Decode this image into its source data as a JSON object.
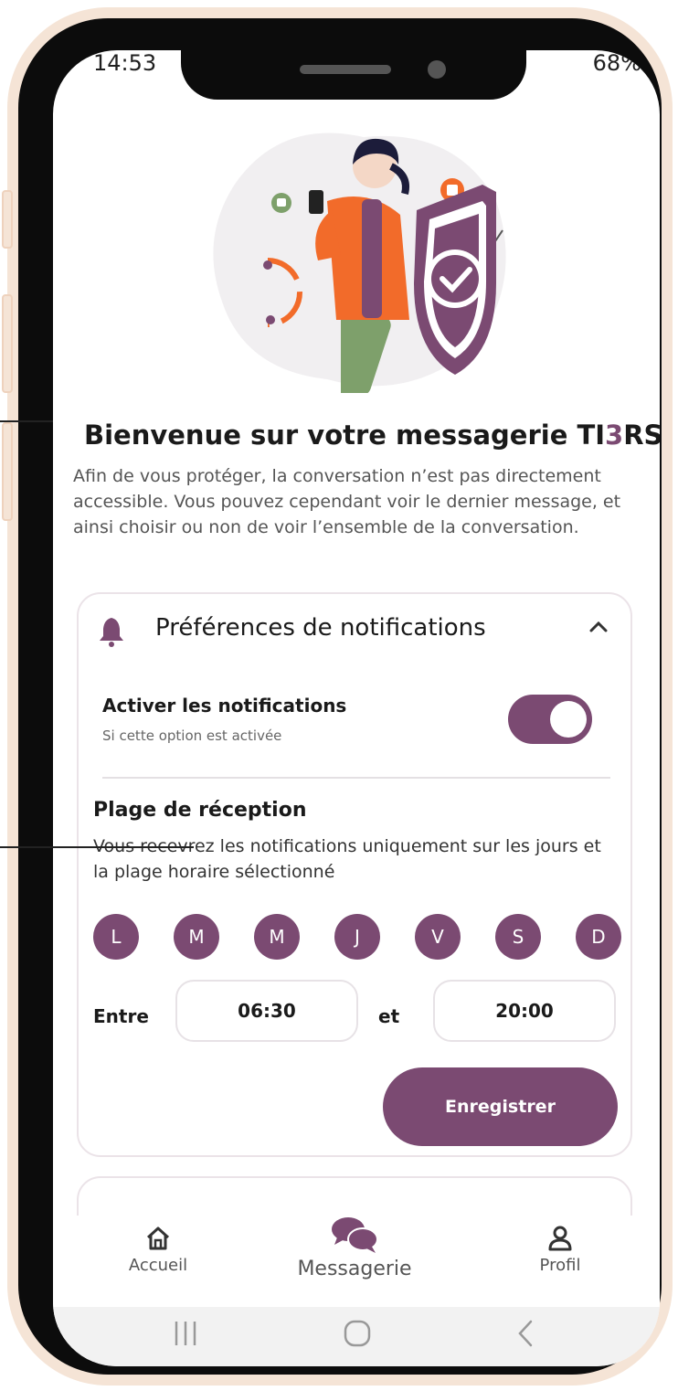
{
  "status": {
    "time": "14:53",
    "battery": "68%"
  },
  "welcome": {
    "title_prefix": "Bienvenue sur votre messagerie TI",
    "title_accent": "3",
    "title_suffix": "RS",
    "description": "Afin de vous protéger, la conversation n’est pas directement accessible. Vous pouvez cependant voir le dernier message, et ainsi choisir ou non de voir l’ensemble de la conversation."
  },
  "notifications": {
    "title": "Préférences de notifications",
    "toggle_label": "Activer les notifications",
    "toggle_hint": "Si cette option est activée",
    "toggle_on": true,
    "plage_title": "Plage de réception",
    "plage_desc": "Vous recevrez les notifications uniquement sur les jours et la plage horaire sélectionné",
    "days": [
      "L",
      "M",
      "M",
      "J",
      "V",
      "S",
      "D"
    ],
    "entre_label": "Entre",
    "et_label": "et",
    "start_time": "06:30",
    "end_time": "20:00",
    "save_label": "Enregistrer"
  },
  "nav": {
    "home": "Accueil",
    "messages": "Messagerie",
    "profile": "Profil",
    "active": "messages"
  },
  "colors": {
    "accent": "#7b4a72",
    "frame": "#f5e4d6",
    "hero_orange": "#f26b2a",
    "hero_green": "#7ea06b"
  },
  "icons": {
    "card_header": "bell-icon",
    "collapse": "chevron-up-icon",
    "home": "home-icon",
    "messages": "chat-bubbles-icon",
    "profile": "user-icon",
    "sys_recents": "recents-icon",
    "sys_home": "system-home-icon",
    "sys_back": "back-icon"
  }
}
